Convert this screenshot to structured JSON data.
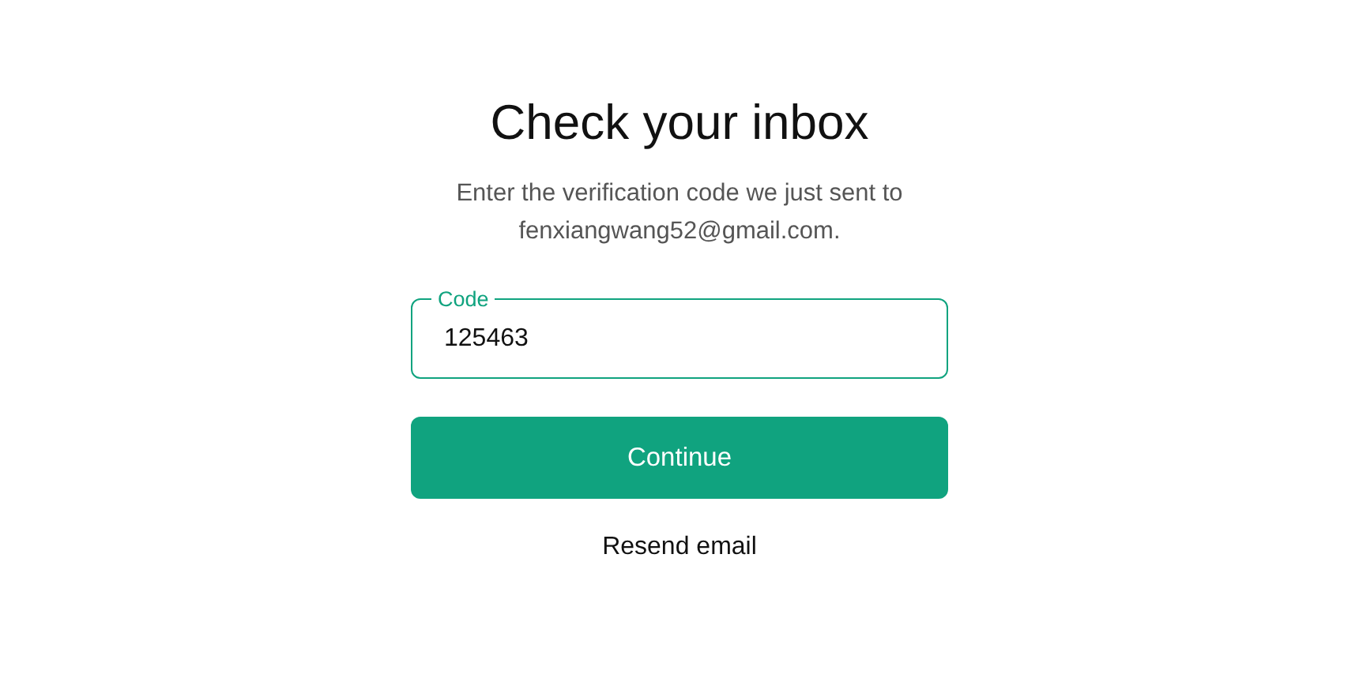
{
  "title": "Check your inbox",
  "subtitle": "Enter the verification code we just sent to fenxiangwang52@gmail.com.",
  "code_field": {
    "label": "Code",
    "value": "125463"
  },
  "continue_button": "Continue",
  "resend_link": "Resend email"
}
